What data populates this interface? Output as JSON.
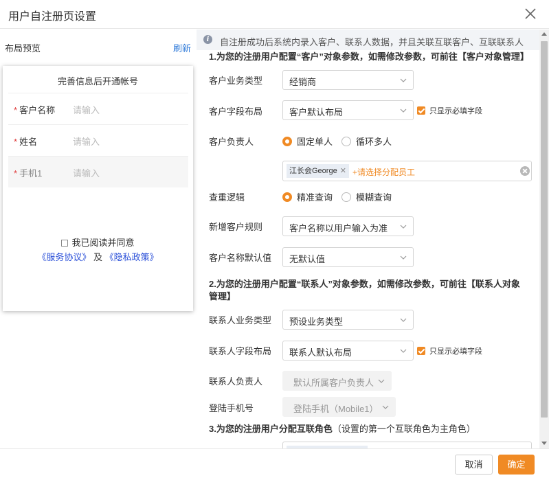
{
  "dialog": {
    "title": "用户自注册页设置"
  },
  "preview": {
    "header": "布局预览",
    "refresh": "刷新",
    "card_title": "完善信息后开通帐号",
    "fields": [
      {
        "label": "客户名称",
        "placeholder": "请输入",
        "required": "*"
      },
      {
        "label": "姓名",
        "placeholder": "请输入",
        "required": "*"
      },
      {
        "label": "手机1",
        "placeholder": "请输入",
        "required": "*"
      }
    ],
    "agree_text": "我已阅读并同意",
    "service_link": "《服务协议》",
    "and_text": "及",
    "privacy_link": "《隐私政策》"
  },
  "config": {
    "tip": "自注册成功后系统内录入客户、联系人数据，并且关联互联客户、互联联系人",
    "section1": {
      "title": "1.为您的注册用户配置“客户”对象参数，如需修改参数，可前往【客户对象管理】"
    },
    "customer_biz_type": {
      "label": "客户业务类型",
      "value": "经销商"
    },
    "customer_layout": {
      "label": "客户字段布局",
      "value": "客户默认布局",
      "checkbox": "只显示必填字段"
    },
    "customer_owner": {
      "label": "客户负责人",
      "options": [
        "固定单人",
        "循环多人"
      ],
      "selected": "固定单人"
    },
    "owner_tag": "江长会George",
    "add_staff": "+请选择分配员工",
    "dedup": {
      "label": "查重逻辑",
      "options": [
        "精准查询",
        "模糊查询"
      ],
      "selected": "精准查询"
    },
    "new_customer_rule": {
      "label": "新增客户规则",
      "value": "客户名称以用户输入为准"
    },
    "customer_name_default": {
      "label": "客户名称默认值",
      "value": "无默认值"
    },
    "section2": {
      "title": "2.为您的注册用户配置“联系人”对象参数，如需修改参数，可前往【联系人对象管理】"
    },
    "contact_biz_type": {
      "label": "联系人业务类型",
      "value": "预设业务类型"
    },
    "contact_layout": {
      "label": "联系人字段布局",
      "value": "联系人默认布局",
      "checkbox": "只显示必填字段"
    },
    "contact_owner": {
      "label": "联系人负责人",
      "value": "默认所属客户负责人"
    },
    "login_phone": {
      "label": "登陆手机号",
      "value": "登陆手机（Mobile1）"
    },
    "section3": {
      "title": "3.为您的注册用户分配互联角色",
      "note": "（设置的第一个互联角色为主角色）"
    }
  },
  "footer": {
    "cancel": "取消",
    "ok": "确定"
  },
  "colors": {
    "accent": "#f08a24",
    "link": "#2a77d8",
    "required": "#e03b3b"
  }
}
